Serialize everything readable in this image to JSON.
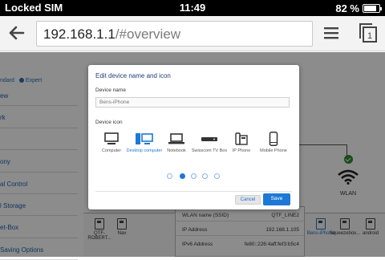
{
  "status_bar": {
    "carrier": "Locked SIM",
    "time": "11:49",
    "battery": "82 %",
    "battery_level": 0.82
  },
  "browser": {
    "url_host": "192.168.1.1",
    "url_path": "/#overview"
  },
  "page": {
    "view_toggle": [
      "ndard",
      "Expert"
    ],
    "diagram_title": "",
    "nav_items": [
      "ew",
      "rk",
      "",
      "ony",
      "al Control",
      "l Storage",
      "et-Box",
      "Saving Options"
    ],
    "wlan_label": "WLAN",
    "devices": [
      {
        "label": "QTF-ROBERT...",
        "selected": false
      },
      {
        "label": "Nav",
        "selected": false
      },
      {
        "label": "Bens-iPhone",
        "selected": true
      },
      {
        "label": "Squeezebox...",
        "selected": false
      },
      {
        "label": "android",
        "selected": false
      }
    ],
    "info_rows": [
      {
        "key": "WLAN name (SSID)",
        "value": "QTF_LINE2"
      },
      {
        "key": "IP Address",
        "value": "192.168.1.105"
      },
      {
        "key": "IPv6 Address",
        "value": "fe80::226:4aff:fef3:b5c4"
      }
    ]
  },
  "modal": {
    "title": "Edit device name and icon",
    "name_label": "Device name",
    "name_value": "Bens-iPhone",
    "icon_label": "Device icon",
    "icons": [
      {
        "name": "computer-icon",
        "label": "Computer",
        "selected": false
      },
      {
        "name": "desktop-computer-icon",
        "label": "Desktop computer",
        "selected": true
      },
      {
        "name": "notebook-icon",
        "label": "Notebook",
        "selected": false
      },
      {
        "name": "tv-box-icon",
        "label": "Swisscom TV Box",
        "selected": false
      },
      {
        "name": "ip-phone-icon",
        "label": "IP Phone",
        "selected": false
      },
      {
        "name": "mobile-phone-icon",
        "label": "Mobile Phone",
        "selected": false
      }
    ],
    "pager_count": 5,
    "pager_active": 1,
    "cancel_label": "Cancel",
    "save_label": "Save"
  },
  "colors": {
    "accent": "#1d78d6",
    "title": "#1f3f73",
    "status_ok": "#2e8b2e"
  }
}
